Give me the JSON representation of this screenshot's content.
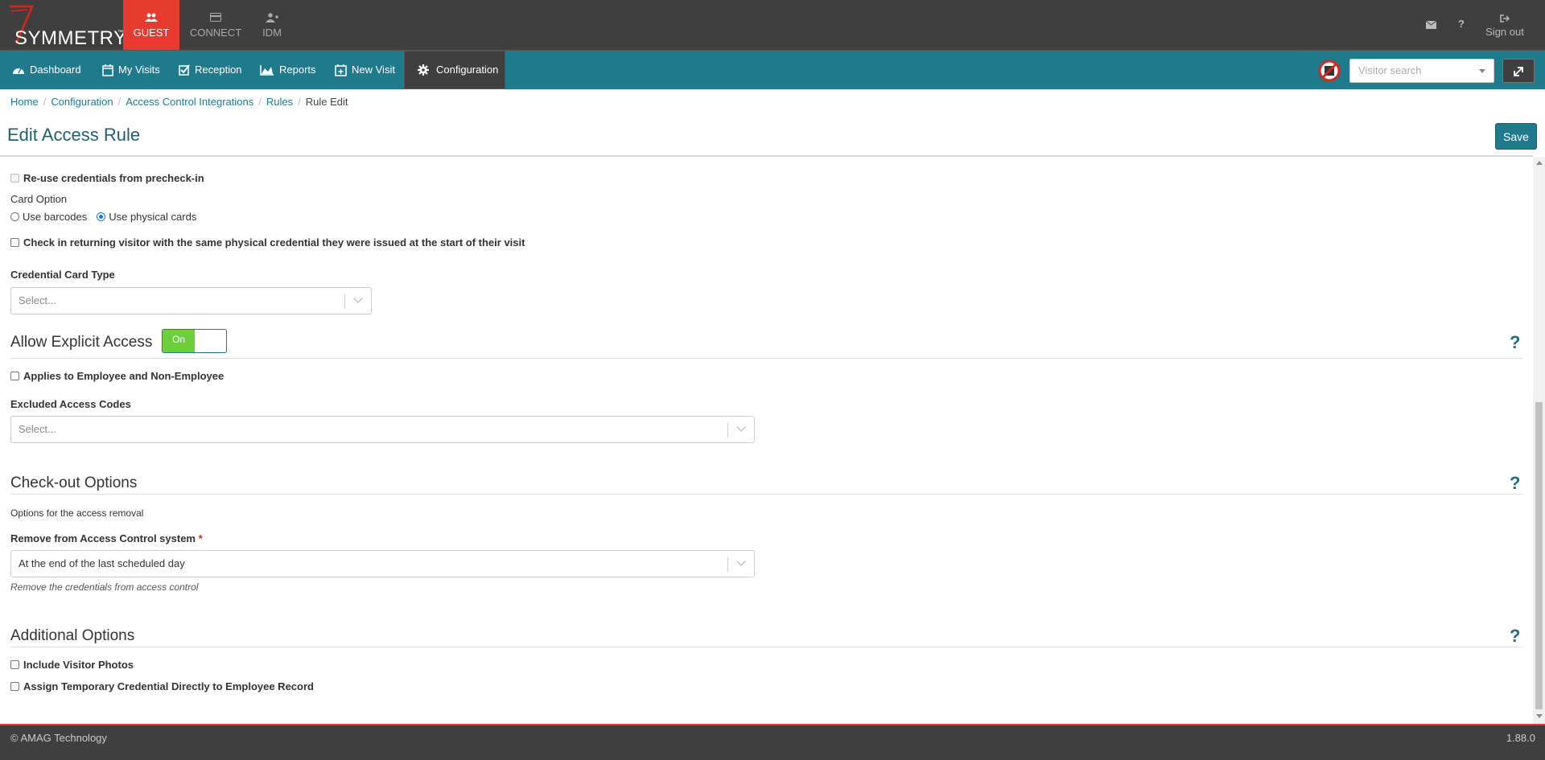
{
  "header": {
    "logo_text": "SYMMETRY",
    "logo_tm": "™",
    "apps": [
      {
        "label": "GUEST",
        "icon": "users-icon",
        "active": true
      },
      {
        "label": "CONNECT",
        "icon": "card-icon",
        "active": false
      },
      {
        "label": "IDM",
        "icon": "user-add-icon",
        "active": false
      }
    ],
    "mail_icon": "mail-icon",
    "help_label": "?",
    "sign_out_label": "Sign out"
  },
  "nav": {
    "items": [
      {
        "label": "Dashboard",
        "icon": "dashboard-icon"
      },
      {
        "label": "My Visits",
        "icon": "calendar-icon"
      },
      {
        "label": "Reception",
        "icon": "check-square-icon"
      },
      {
        "label": "Reports",
        "icon": "area-chart-icon"
      },
      {
        "label": "New Visit",
        "icon": "calendar-plus-icon"
      },
      {
        "label": "Configuration",
        "icon": "gear-icon",
        "active": true
      }
    ],
    "visitor_search_placeholder": "Visitor search"
  },
  "breadcrumb": [
    "Home",
    "Configuration",
    "Access Control Integrations",
    "Rules",
    "Rule Edit"
  ],
  "page": {
    "title": "Edit Access Rule",
    "save_label": "Save"
  },
  "form": {
    "reuse_credentials_label": "Re-use credentials from precheck-in",
    "card_option_label": "Card Option",
    "card_option_barcodes": "Use barcodes",
    "card_option_physical": "Use physical cards",
    "card_option_selected": "Use physical cards",
    "returning_visitor_label": "Check in returning visitor with the same physical credential they were issued at the start of their visit",
    "credential_card_type_label": "Credential Card Type",
    "credential_card_type_placeholder": "Select...",
    "explicit_access": {
      "title": "Allow Explicit Access",
      "toggle_label": "On",
      "toggle_on": true,
      "applies_label": "Applies to Employee and Non-Employee",
      "excluded_codes_label": "Excluded Access Codes",
      "excluded_codes_placeholder": "Select..."
    },
    "checkout": {
      "title": "Check-out Options",
      "description": "Options for the access removal",
      "remove_label": "Remove from Access Control system",
      "required_mark": "*",
      "remove_value": "At the end of the last scheduled day",
      "remove_hint": "Remove the credentials from access control"
    },
    "additional": {
      "title": "Additional Options",
      "include_photos_label": "Include Visitor Photos",
      "assign_temp_label": "Assign Temporary Credential Directly to Employee Record"
    },
    "help_mark": "?"
  },
  "footer": {
    "copyright": "© AMAG Technology",
    "version": "1.88.0"
  },
  "colors": {
    "brand_teal": "#1f7a8c",
    "header_dark": "#3f3f3f",
    "guest_red": "#e63b2e",
    "toggle_green": "#6ccf3a"
  }
}
